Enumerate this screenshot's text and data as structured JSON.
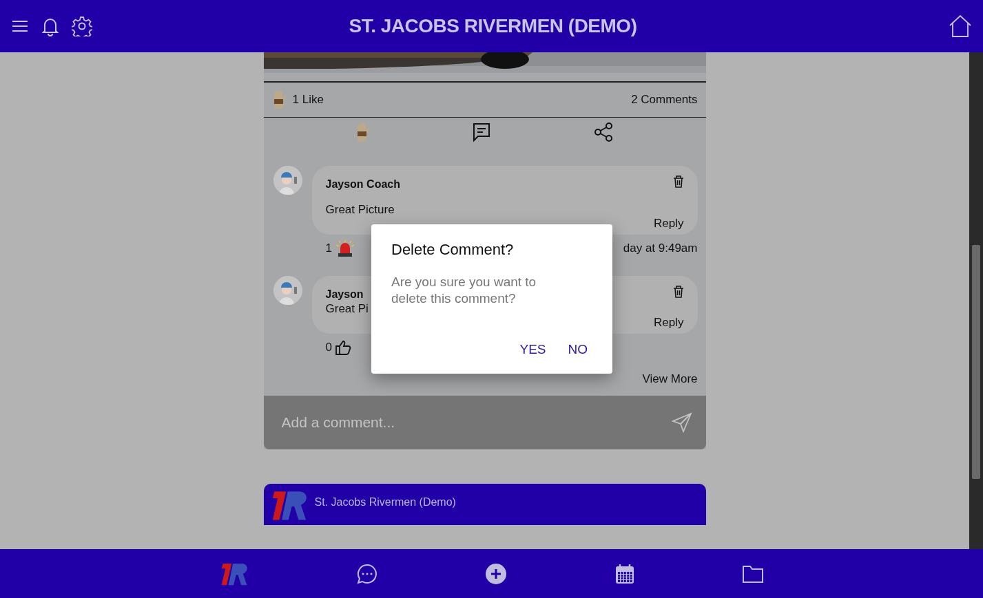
{
  "header": {
    "title": "ST. JACOBS RIVERMEN (DEMO)"
  },
  "post": {
    "likes": "1 Like",
    "comments_count": "2 Comments"
  },
  "comments": [
    {
      "author": "Jayson Coach",
      "text": "Great Picture",
      "reply": "Reply",
      "count": "1",
      "kind": "siren",
      "time": "day at 9:49am"
    },
    {
      "author": "Jayson",
      "text": "Great Pi",
      "reply": "Reply",
      "count": "0",
      "kind": "thumb"
    }
  ],
  "view_more": "View More",
  "comment_input": {
    "placeholder": "Add a comment..."
  },
  "next_post": {
    "team": "St. Jacobs Rivermen (Demo)"
  },
  "dialog": {
    "title": "Delete Comment?",
    "message": "Are you sure you want to delete this comment?",
    "buttons": [
      "YES",
      "NO"
    ]
  },
  "nav": [
    {
      "kind": "logo"
    },
    {
      "kind": "chat"
    },
    {
      "kind": "add"
    },
    {
      "kind": "calendar"
    },
    {
      "kind": "folder"
    }
  ]
}
